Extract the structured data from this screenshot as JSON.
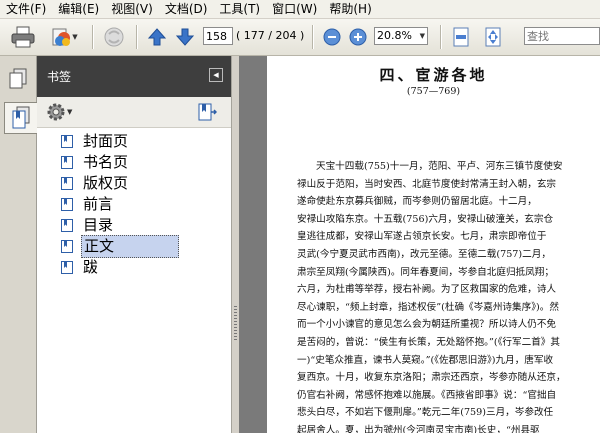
{
  "menu": [
    "文件(F)",
    "编辑(E)",
    "视图(V)",
    "文档(D)",
    "工具(T)",
    "窗口(W)",
    "帮助(H)"
  ],
  "toolbar": {
    "page_number": "158",
    "page_count": "( 177 / 204 )",
    "zoom": "20.8%",
    "search_placeholder": "查找"
  },
  "panel": {
    "title": "书签"
  },
  "bookmarks": [
    {
      "label": "封面页",
      "selected": false
    },
    {
      "label": "书名页",
      "selected": false
    },
    {
      "label": "版权页",
      "selected": false
    },
    {
      "label": "前言",
      "selected": false
    },
    {
      "label": "目录",
      "selected": false
    },
    {
      "label": "正文",
      "selected": true
    },
    {
      "label": "跋",
      "selected": false
    }
  ],
  "document": {
    "title": "四、宦游各地",
    "subtitle": "(757—769)",
    "lines": [
      {
        "text": "天宝十四载(755)十一月，范阳、平卢、河东三镇节度使安",
        "indent": true
      },
      {
        "text": "禄山反于范阳，当时安西、北庭节度使封常清王封入朝，玄宗",
        "indent": false
      },
      {
        "text": "遂命使赴东京募兵御贼，而岑参则仍留居北庭。十二月，",
        "indent": false
      },
      {
        "text": "安禄山攻陷东京。十五载(756)六月，安禄山破潼关，玄宗仓",
        "indent": false
      },
      {
        "text": "皇逃往成都，安禄山军遂占领京长安。七月，肃宗即帝位于",
        "indent": false
      },
      {
        "text": "灵武(今宁夏灵武市西南)，改元至德。至德二载(757)二月，",
        "indent": false
      },
      {
        "text": "肃宗至凤翔(今属陕西)。同年春夏间，岑参自北庭归抵凤翔；",
        "indent": false
      },
      {
        "text": "六月，为杜甫等举荐，授右补阙。为了区救国家的危难，诗人",
        "indent": false
      },
      {
        "text": "尽心谏职，“频上封章，指述权佞”(杜确《岑嘉州诗集序》)。然",
        "indent": false
      },
      {
        "text": "而一个小小谏官的意见怎么会为朝廷所重视？所以诗人仍不免",
        "indent": false
      },
      {
        "text": "是苦闷的，曾说：“侯生有长策，无处豁怀抱。”(《行军二首》其",
        "indent": false
      },
      {
        "text": "一)“史笔众推直，谏书人莫窥。”(《佐郡思旧游》)九月，唐军收",
        "indent": false
      },
      {
        "text": "复西京。十月，收复东京洛阳；肃宗还西京，岑参亦随从还京，",
        "indent": false
      },
      {
        "text": "仍官右补阙，常感怀抱难以施展。《西掖省即事》说：“官拙自",
        "indent": false
      },
      {
        "text": "悲头白尽，不如岩下偃荆扉。”乾元二年(759)三月，岑参改任",
        "indent": false
      },
      {
        "text": "起居舍人。夏，出为虢州(今河南灵宝市南)长史，“州县驱",
        "indent": false
      }
    ]
  },
  "colors": {
    "panel_header": "#3e3e3e",
    "selected_bookmark": "#c6d3ee",
    "doc_background": "#7a7a7a",
    "arrow_blue": "#3a74c8"
  }
}
